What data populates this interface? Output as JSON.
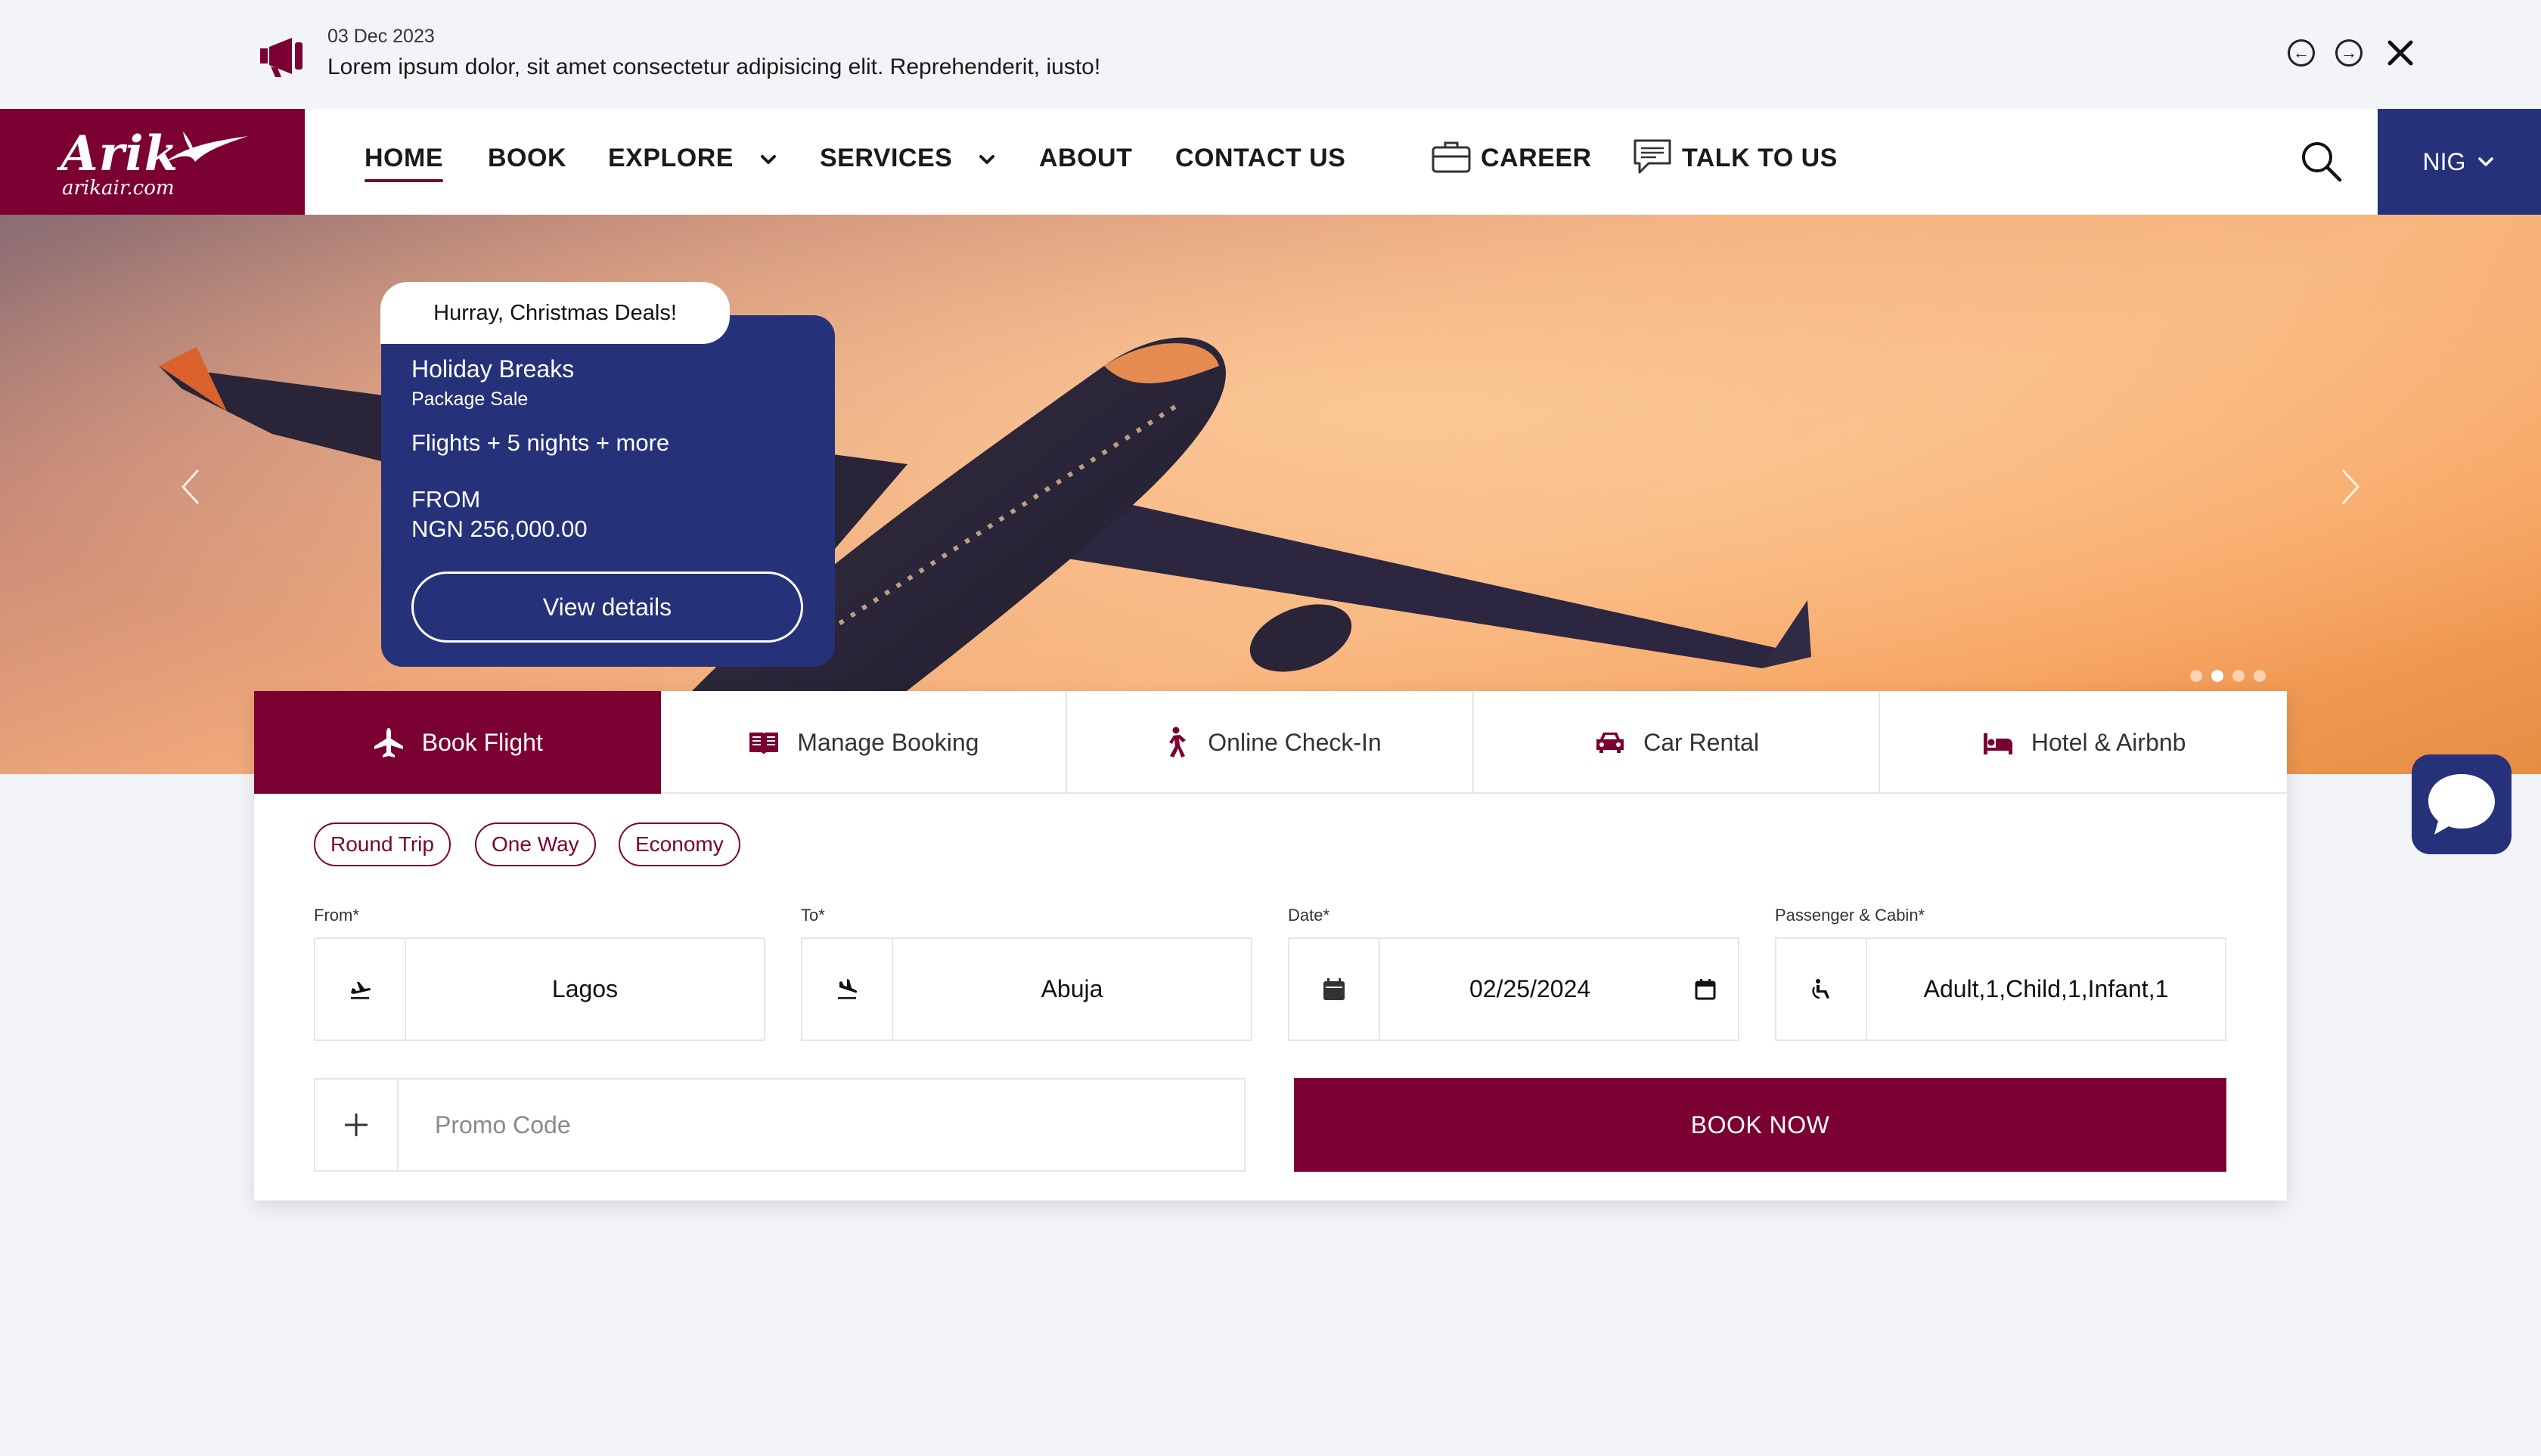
{
  "announcement": {
    "date": "03 Dec 2023",
    "message": "Lorem ipsum dolor, sit amet consectetur adipisicing elit. Reprehenderit, iusto!",
    "icons": [
      "megaphone-icon",
      "arrow-left-circle-icon",
      "arrow-right-circle-icon",
      "close-icon"
    ]
  },
  "logo": {
    "brand": "Arik",
    "domain": "arikair.com"
  },
  "nav": {
    "home": "HOME",
    "book": "BOOK",
    "explore": "EXPLORE",
    "services": "SERVICES",
    "about": "ABOUT",
    "contact": "CONTACT US",
    "career": "CAREER",
    "talk": "TALK TO US",
    "region": "NIG"
  },
  "promo": {
    "tag": "Hurray, Christmas Deals!",
    "title": "Holiday Breaks",
    "subtitle": "Package Sale",
    "description": "Flights + 5 nights + more",
    "from_label": "FROM",
    "price": "NGN 256,000.00",
    "button": "View details"
  },
  "carousel": {
    "slides": 4,
    "active_index": 1
  },
  "tabs": [
    {
      "label": "Book Flight",
      "icon": "airplane-icon",
      "active": true
    },
    {
      "label": "Manage Booking",
      "icon": "book-icon",
      "active": false
    },
    {
      "label": "Online Check-In",
      "icon": "walking-person-icon",
      "active": false
    },
    {
      "label": "Car Rental",
      "icon": "car-icon",
      "active": false
    },
    {
      "label": "Hotel & Airbnb",
      "icon": "bed-icon",
      "active": false
    }
  ],
  "trip_options": [
    "Round Trip",
    "One Way",
    "Economy"
  ],
  "form": {
    "from": {
      "label": "From*",
      "value": "Lagos"
    },
    "to": {
      "label": "To*",
      "value": "Abuja"
    },
    "date": {
      "label": "Date*",
      "value": "02/25/2024"
    },
    "passenger": {
      "label": "Passenger & Cabin*",
      "value": "Adult,1,Child,1,Infant,1"
    },
    "promo_placeholder": "Promo Code",
    "book_button": "BOOK NOW"
  },
  "colors": {
    "brand_maroon": "#7a0132",
    "brand_navy": "#25327a",
    "page_bg": "#f2f4f7"
  }
}
